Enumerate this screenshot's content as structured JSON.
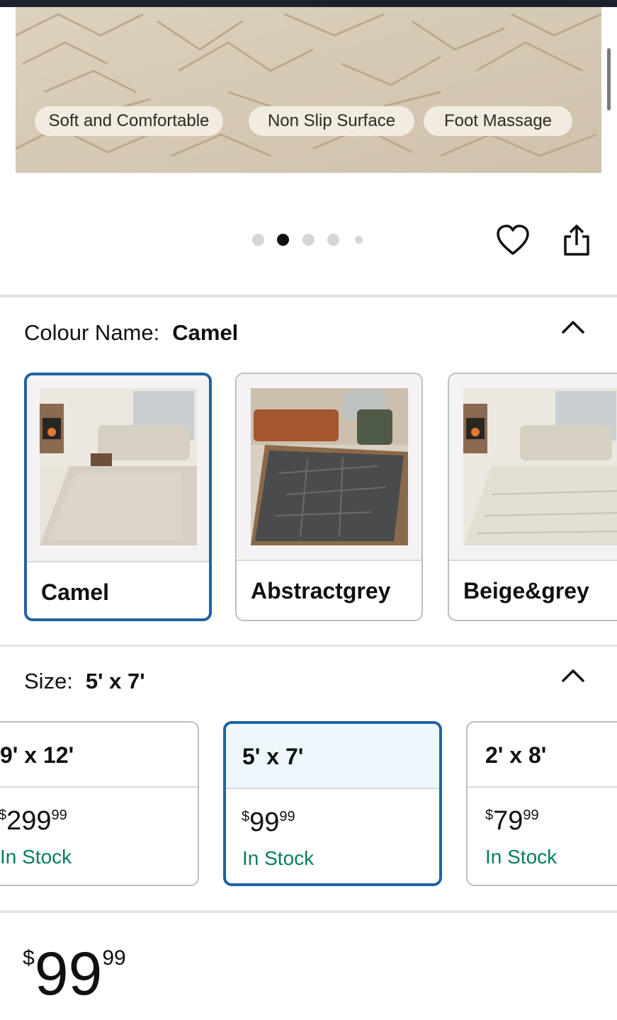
{
  "hero": {
    "features": [
      "Soft and Comfortable",
      "Non Slip Surface",
      "Foot Massage"
    ]
  },
  "carousel": {
    "total_images": 5,
    "active_index": 1
  },
  "actions": {
    "favorite_icon": "heart-icon",
    "share_icon": "share-icon"
  },
  "colour": {
    "label": "Colour Name:",
    "selected": "Camel",
    "options": [
      {
        "name": "Camel",
        "selected": true
      },
      {
        "name": "Abstractgrey",
        "selected": false
      },
      {
        "name": "Beige&grey",
        "selected": false
      }
    ]
  },
  "size": {
    "label": "Size:",
    "selected": "5' x 7'",
    "options": [
      {
        "label": "9' x 12'",
        "currency": "$",
        "whole": "299",
        "cents": "99",
        "stock": "In Stock",
        "selected": false
      },
      {
        "label": "5' x 7'",
        "currency": "$",
        "whole": "99",
        "cents": "99",
        "stock": "In Stock",
        "selected": true
      },
      {
        "label": "2' x 8'",
        "currency": "$",
        "whole": "79",
        "cents": "99",
        "stock": "In Stock",
        "selected": false
      }
    ]
  },
  "price": {
    "currency": "$",
    "whole": "99",
    "cents": "99"
  },
  "colors": {
    "accent": "#2162a1",
    "stock": "#067d62",
    "selected_bg": "#edf7fc"
  }
}
